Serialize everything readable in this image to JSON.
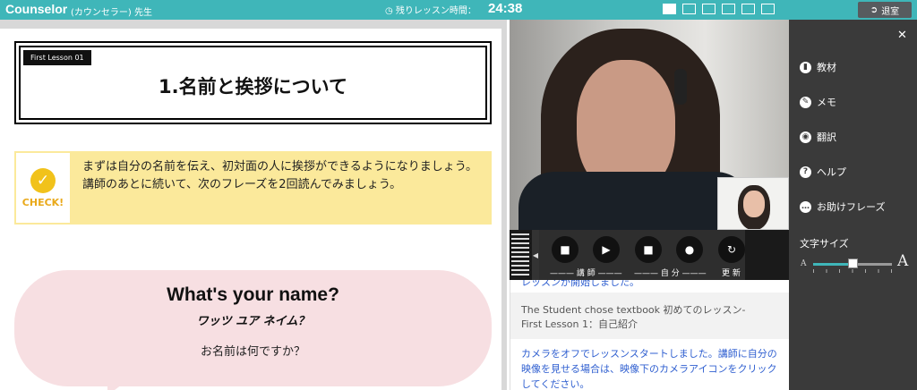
{
  "topbar": {
    "brand": "Counselor",
    "brand_sub": "(カウンセラー) 先生",
    "timer_label": "残りレッスン時間：",
    "timer_value": "24:38",
    "timer_icon": "clock-icon",
    "layout_icons": [
      "layout-1",
      "layout-2",
      "layout-3",
      "layout-4",
      "layout-5",
      "layout-6"
    ],
    "exit_label": "退室",
    "exit_icon": "exit-icon",
    "accent_color": "#3fb6b9"
  },
  "textbook": {
    "lesson_tag": "First Lesson 01",
    "title": "1.名前と挨拶について",
    "check_label": "CHECK!",
    "check_text_1": "まずは自分の名前を伝え、初対面の人に挨拶ができるようになりましょう。",
    "check_text_2": "講師のあとに続いて、次のフレーズを2回読んでみましょう。",
    "phrase_en": "What's your name?",
    "phrase_kana": "ワッツ ユア ネイム？",
    "phrase_ja": "お名前は何ですか？"
  },
  "controls": {
    "teacher_label": "講 師",
    "self_label": "自 分",
    "refresh_label": "更 新"
  },
  "chat": {
    "msg1": "レッスンが開始しました。",
    "msg2_line1": "The Student chose textbook 初めてのレッスン-",
    "msg2_line2": "First Lesson 1：自己紹介",
    "msg3": "カメラをオフでレッスンスタートしました。講師に自分の映像を見せる場合は、映像下のカメラアイコンをクリックしてください。"
  },
  "sidebar": {
    "items": [
      {
        "label": "教材",
        "icon": "book-icon"
      },
      {
        "label": "メモ",
        "icon": "edit-icon"
      },
      {
        "label": "翻訳",
        "icon": "globe-icon"
      },
      {
        "label": "ヘルプ",
        "icon": "help-icon"
      },
      {
        "label": "お助けフレーズ",
        "icon": "chat-bubble-icon"
      }
    ],
    "font_size_label": "文字サイズ",
    "font_small": "A",
    "font_large": "A",
    "font_size_level": 0.5
  }
}
